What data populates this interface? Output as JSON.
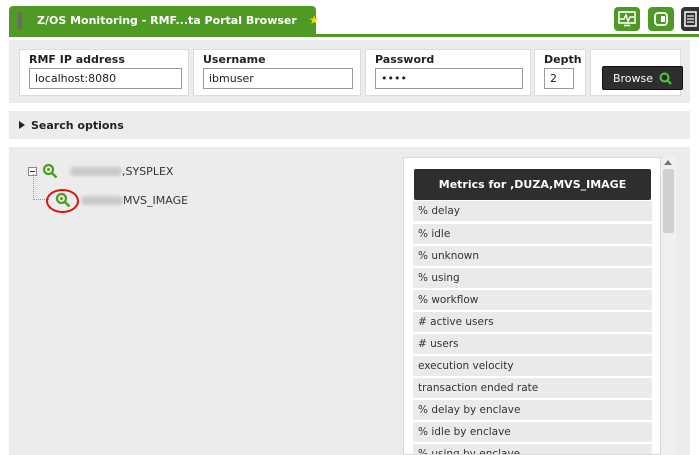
{
  "tab": {
    "title": "Z/OS Monitoring - RMF...ta Portal Browser",
    "star": "★"
  },
  "form": {
    "ip": {
      "label": "RMF IP address",
      "value": "localhost:8080"
    },
    "username": {
      "label": "Username",
      "value": "ibmuser"
    },
    "password": {
      "label": "Password",
      "value": "••••"
    },
    "depth": {
      "label": "Depth",
      "value": "2"
    },
    "browse_label": "Browse"
  },
  "search_options_label": "Search options",
  "tree": {
    "root_label": ",SYSPLEX",
    "child_label": "MVS_IMAGE"
  },
  "metrics": {
    "header": "Metrics for ,DUZA,MVS_IMAGE",
    "items": [
      "% delay",
      "% idle",
      "% unknown",
      "% using",
      "% workflow",
      "# active users",
      "# users",
      "execution velocity",
      "transaction ended rate",
      "% delay by enclave",
      "% idle by enclave",
      "% using by enclave"
    ]
  },
  "colors": {
    "accent": "#4f9a25",
    "dark": "#2e2e2e",
    "highlight": "#e01010"
  },
  "icons": [
    "monitor-icon",
    "plug-icon",
    "document-icon",
    "search-icon",
    "star-icon"
  ]
}
